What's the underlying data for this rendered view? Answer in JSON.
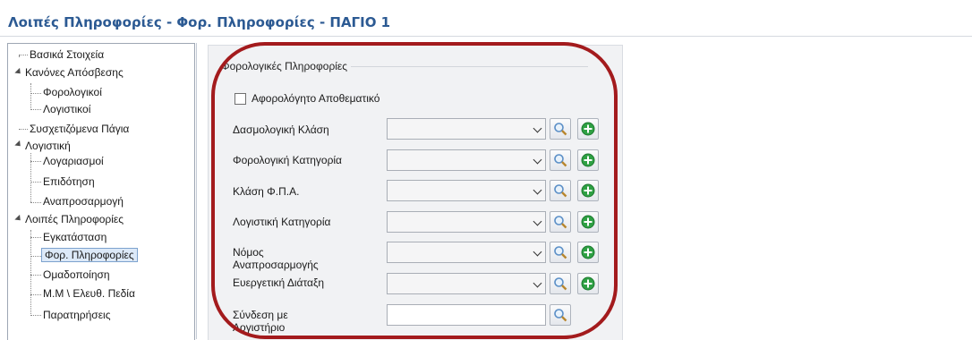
{
  "window": {
    "title": "Λοιπές Πληροφορίες - Φορ. Πληροφορίες - ΠΑΓΙΟ 1"
  },
  "tree": {
    "items": [
      {
        "label": "Βασικά Στοιχεία"
      },
      {
        "label": "Κανόνες Απόσβεσης"
      },
      {
        "label": "Φορολογικοί"
      },
      {
        "label": "Λογιστικοί"
      },
      {
        "label": "Συσχετιζόμενα Πάγια"
      },
      {
        "label": "Λογιστική"
      },
      {
        "label": "Λογαριασμοί"
      },
      {
        "label": "Επιδότηση"
      },
      {
        "label": "Αναπροσαρμογή"
      },
      {
        "label": "Λοιπές Πληροφορίες"
      },
      {
        "label": "Εγκατάσταση"
      },
      {
        "label": "Φορ. Πληροφορίες"
      },
      {
        "label": "Ομαδοποίηση"
      },
      {
        "label": "Μ.Μ \\ Ελευθ. Πεδία"
      },
      {
        "label": "Παρατηρήσεις"
      }
    ],
    "selected": "Φορ. Πληροφορίες"
  },
  "form": {
    "group_title": "Φορολογικές Πληροφορίες",
    "checkbox_label": "Αφορολόγητο Αποθεματικό",
    "checkbox_checked": false,
    "fields": [
      {
        "label": "Δασμολογική Κλάση",
        "value": ""
      },
      {
        "label": "Φορολογική Κατηγορία",
        "value": ""
      },
      {
        "label": "Κλάση Φ.Π.Α.",
        "value": ""
      },
      {
        "label": "Λογιστική Κατηγορία",
        "value": ""
      },
      {
        "label": "Νόμος Αναπροσαρμογής",
        "value": ""
      },
      {
        "label": "Ευεργετική Διάταξη",
        "value": ""
      },
      {
        "label": "Σύνδεση με Λογιστήριο",
        "value": ""
      }
    ]
  },
  "icons": {
    "dropdown": "chevron-down-icon",
    "search": "magnifier-icon",
    "add": "green-plus-icon"
  },
  "colors": {
    "title": "#2c5a93",
    "annotation": "#a31b1d",
    "selection": "#dce9f8",
    "add_icon": "#2ea043"
  }
}
